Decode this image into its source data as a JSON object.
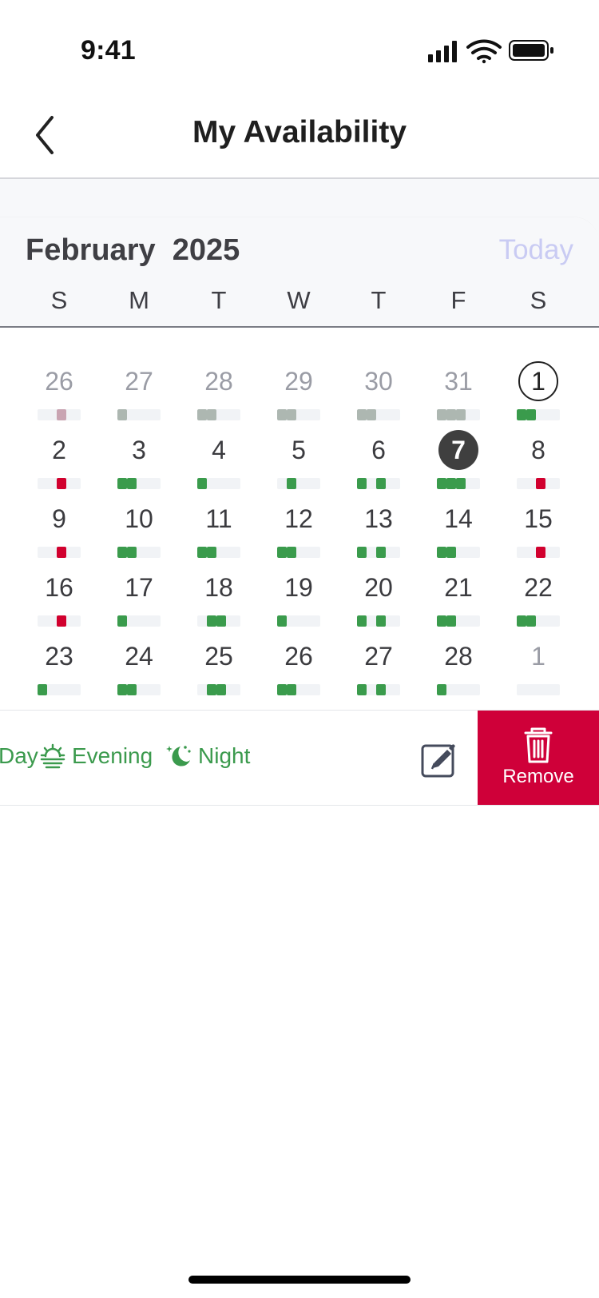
{
  "status_bar": {
    "time": "9:41",
    "icons": [
      "cellular-signal-icon",
      "wifi-icon",
      "battery-icon"
    ]
  },
  "navigation": {
    "title": "My Availability",
    "back_icon": "chevron-left-icon"
  },
  "calendar": {
    "month_label": "February  2025",
    "today_label": "Today",
    "weekday_labels": [
      "S",
      "M",
      "T",
      "W",
      "T",
      "F",
      "S"
    ],
    "colors": {
      "available": "#3A9B4C",
      "unavailable": "#D1002E",
      "past_available": "#ADB7B1",
      "past_unavailable": "#C9A4B2",
      "selected": "#3F3F3F",
      "today_label": "#C9CBF3"
    },
    "days": [
      {
        "label": "26",
        "state": "outside",
        "segments": [
          "empty",
          "empty",
          "muted-red"
        ]
      },
      {
        "label": "27",
        "state": "outside",
        "segments": [
          "muted-green",
          "empty",
          "empty"
        ]
      },
      {
        "label": "28",
        "state": "outside",
        "segments": [
          "muted-green",
          "muted-green",
          "empty"
        ]
      },
      {
        "label": "29",
        "state": "outside",
        "segments": [
          "muted-green",
          "muted-green",
          "empty"
        ]
      },
      {
        "label": "30",
        "state": "outside",
        "segments": [
          "muted-green",
          "muted-green",
          "empty"
        ]
      },
      {
        "label": "31",
        "state": "outside",
        "segments": [
          "muted-green",
          "muted-green",
          "muted-green"
        ]
      },
      {
        "label": "1",
        "state": "current-circled",
        "segments": [
          "green",
          "green",
          "empty"
        ]
      },
      {
        "label": "2",
        "state": "normal",
        "segments": [
          "empty",
          "empty",
          "red"
        ]
      },
      {
        "label": "3",
        "state": "normal",
        "segments": [
          "green",
          "green",
          "empty"
        ]
      },
      {
        "label": "4",
        "state": "normal",
        "segments": [
          "green",
          "empty",
          "empty"
        ]
      },
      {
        "label": "5",
        "state": "normal",
        "segments": [
          "empty",
          "green",
          "empty"
        ]
      },
      {
        "label": "6",
        "state": "normal",
        "segments": [
          "green",
          "empty",
          "green"
        ]
      },
      {
        "label": "7",
        "state": "selected",
        "segments": [
          "green",
          "green",
          "green"
        ]
      },
      {
        "label": "8",
        "state": "normal",
        "segments": [
          "empty",
          "empty",
          "red"
        ]
      },
      {
        "label": "9",
        "state": "normal",
        "segments": [
          "empty",
          "empty",
          "red"
        ]
      },
      {
        "label": "10",
        "state": "normal",
        "segments": [
          "green",
          "green",
          "empty"
        ]
      },
      {
        "label": "11",
        "state": "normal",
        "segments": [
          "green",
          "green",
          "empty"
        ]
      },
      {
        "label": "12",
        "state": "normal",
        "segments": [
          "green",
          "green",
          "empty"
        ]
      },
      {
        "label": "13",
        "state": "normal",
        "segments": [
          "green",
          "empty",
          "green"
        ]
      },
      {
        "label": "14",
        "state": "normal",
        "segments": [
          "green",
          "green",
          "empty"
        ]
      },
      {
        "label": "15",
        "state": "normal",
        "segments": [
          "empty",
          "empty",
          "red"
        ]
      },
      {
        "label": "16",
        "state": "normal",
        "segments": [
          "empty",
          "empty",
          "red"
        ]
      },
      {
        "label": "17",
        "state": "normal",
        "segments": [
          "green",
          "empty",
          "empty"
        ]
      },
      {
        "label": "18",
        "state": "normal",
        "segments": [
          "empty",
          "green",
          "green"
        ]
      },
      {
        "label": "19",
        "state": "normal",
        "segments": [
          "green",
          "empty",
          "empty"
        ]
      },
      {
        "label": "20",
        "state": "normal",
        "segments": [
          "green",
          "empty",
          "green"
        ]
      },
      {
        "label": "21",
        "state": "normal",
        "segments": [
          "green",
          "green",
          "empty"
        ]
      },
      {
        "label": "22",
        "state": "normal",
        "segments": [
          "green",
          "green",
          "empty"
        ]
      },
      {
        "label": "23",
        "state": "normal",
        "segments": [
          "green",
          "empty",
          "empty"
        ]
      },
      {
        "label": "24",
        "state": "normal",
        "segments": [
          "green",
          "green",
          "empty"
        ]
      },
      {
        "label": "25",
        "state": "normal",
        "segments": [
          "empty",
          "green",
          "green"
        ]
      },
      {
        "label": "26",
        "state": "normal",
        "segments": [
          "green",
          "green",
          "empty"
        ]
      },
      {
        "label": "27",
        "state": "normal",
        "segments": [
          "green",
          "empty",
          "green"
        ]
      },
      {
        "label": "28",
        "state": "normal",
        "segments": [
          "green",
          "empty",
          "empty"
        ]
      },
      {
        "label": "1",
        "state": "outside",
        "segments": [
          "empty",
          "empty",
          "empty"
        ]
      }
    ]
  },
  "legend": {
    "day_label": "Day",
    "evening_label": "Evening",
    "night_label": "Night",
    "evening_icon": "sunrise-icon",
    "night_icon": "moon-stars-icon",
    "edit_icon": "edit-icon"
  },
  "remove": {
    "label": "Remove",
    "icon": "trash-icon",
    "color": "#CF0039"
  }
}
